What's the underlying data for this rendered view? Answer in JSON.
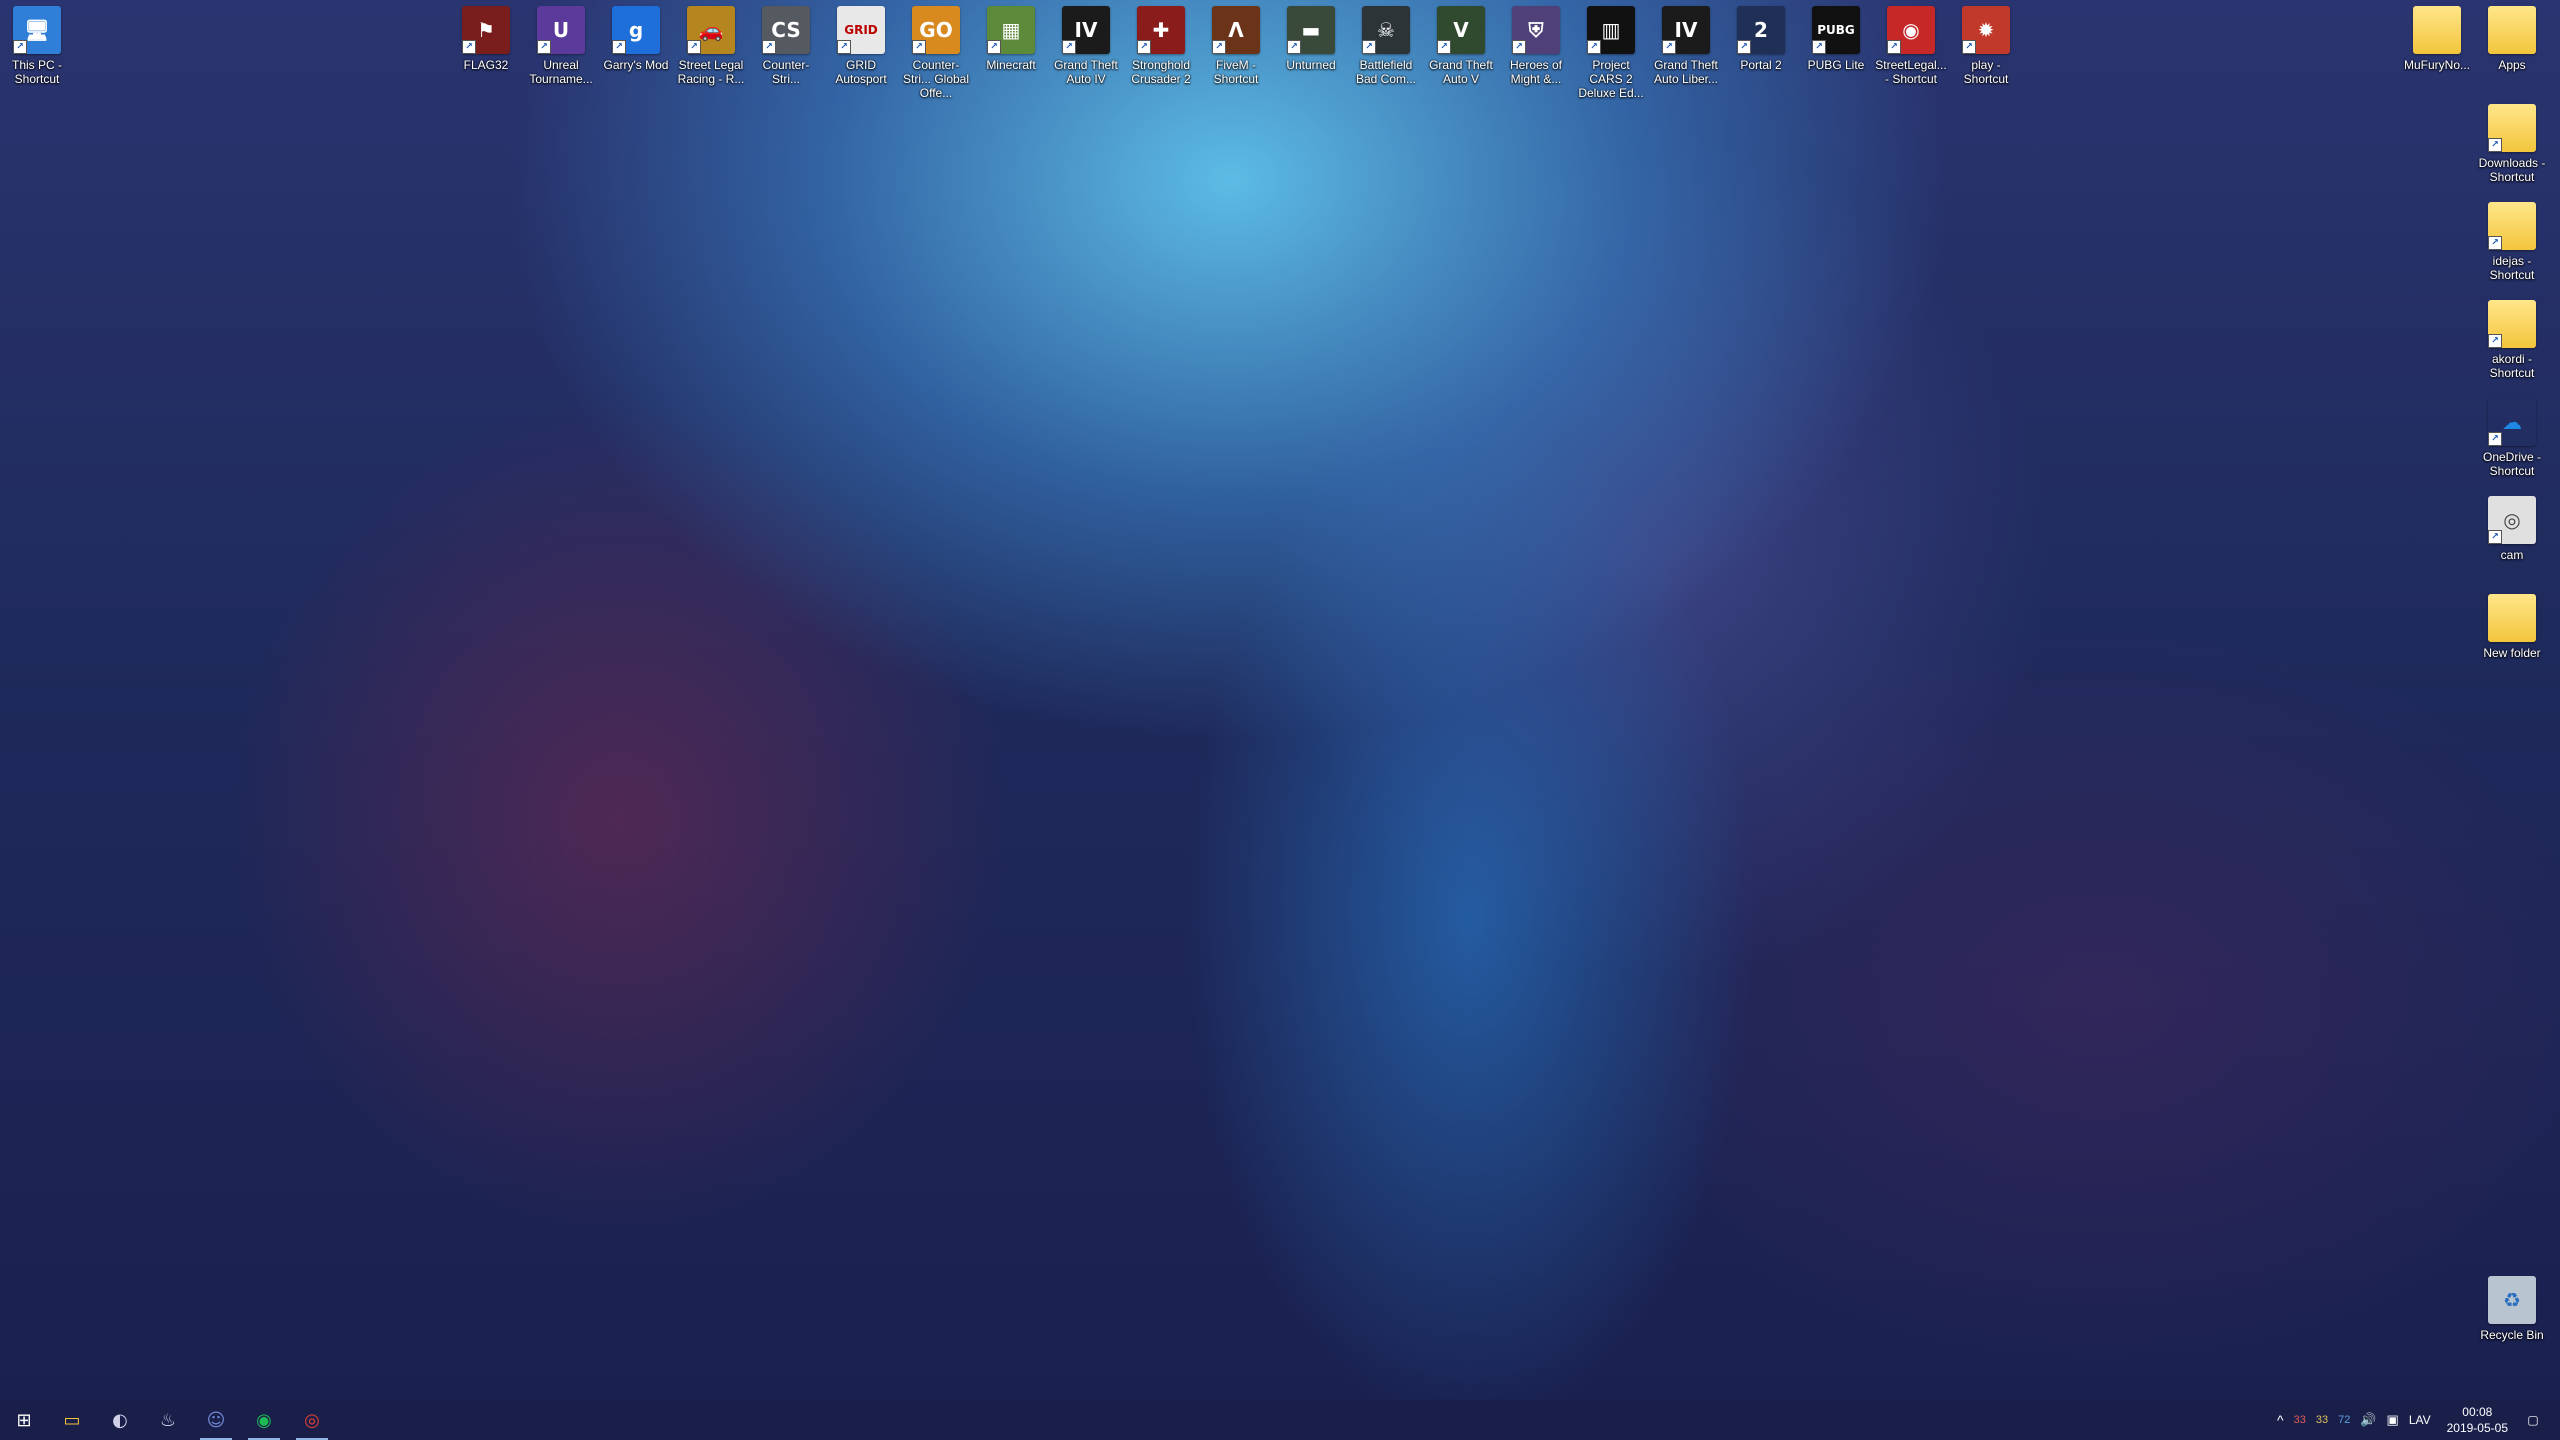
{
  "desktop": {
    "left_icons": [
      {
        "label": "This PC - Shortcut",
        "icon": "this-pc-icon"
      }
    ],
    "top_icons": [
      {
        "label": "FLAG32",
        "icon": "flag-game-icon",
        "color": "#7a1d1d",
        "glyph": "⚑"
      },
      {
        "label": "Unreal Tourname...",
        "icon": "unreal-icon",
        "color": "#5b3a9b",
        "glyph": "U"
      },
      {
        "label": "Garry's Mod",
        "icon": "garrys-mod-icon",
        "color": "#1e6fd9",
        "glyph": "g"
      },
      {
        "label": "Street Legal Racing - R...",
        "icon": "street-legal-car-icon",
        "color": "#b5851f",
        "glyph": "🚗"
      },
      {
        "label": "Counter-Stri...",
        "icon": "counter-strike-icon",
        "color": "#555a60",
        "glyph": "CS"
      },
      {
        "label": "GRID Autosport",
        "icon": "grid-autosport-icon",
        "color": "#e8e8e8",
        "glyph": "GRID"
      },
      {
        "label": "Counter-Stri... Global Offe...",
        "icon": "csgo-icon",
        "color": "#d98a1f",
        "glyph": "GO"
      },
      {
        "label": "Minecraft",
        "icon": "minecraft-icon",
        "color": "#5d8a3a",
        "glyph": "▦"
      },
      {
        "label": "Grand Theft Auto IV",
        "icon": "gta4-icon",
        "color": "#1b1b1b",
        "glyph": "IV"
      },
      {
        "label": "Stronghold Crusader 2",
        "icon": "stronghold-shield-icon",
        "color": "#8b1c1c",
        "glyph": "✚"
      },
      {
        "label": "FiveM - Shortcut",
        "icon": "fivem-icon",
        "color": "#6b3317",
        "glyph": "Λ"
      },
      {
        "label": "Unturned",
        "icon": "unturned-icon",
        "color": "#3a4a3a",
        "glyph": "▬"
      },
      {
        "label": "Battlefield Bad Com...",
        "icon": "battlefield-icon",
        "color": "#2c3438",
        "glyph": "☠"
      },
      {
        "label": "Grand Theft Auto V",
        "icon": "gta5-icon",
        "color": "#2f4a2f",
        "glyph": "V"
      },
      {
        "label": "Heroes of Might &...",
        "icon": "heroes-shield-icon",
        "color": "#50407a",
        "glyph": "⛨"
      },
      {
        "label": "Project CARS 2 Deluxe Ed...",
        "icon": "project-cars-icon",
        "color": "#111111",
        "glyph": "▥"
      },
      {
        "label": "Grand Theft Auto Liber...",
        "icon": "gta-liberty-icon",
        "color": "#1b1b1b",
        "glyph": "IV"
      },
      {
        "label": "Portal 2",
        "icon": "portal2-icon",
        "color": "#1f2f55",
        "glyph": "2"
      },
      {
        "label": "PUBG Lite",
        "icon": "pubg-lite-icon",
        "color": "#111111",
        "glyph": "PUBG"
      },
      {
        "label": "StreetLegal... - Shortcut",
        "icon": "streetlegal-disc-icon",
        "color": "#c62828",
        "glyph": "◉"
      },
      {
        "label": "play - Shortcut",
        "icon": "play-game-icon",
        "color": "#c0392b",
        "glyph": "✹"
      }
    ],
    "right_top_icons": [
      {
        "label": "MuFuryNo...",
        "icon": "folder-icon"
      },
      {
        "label": "Apps",
        "icon": "folder-warning-icon"
      }
    ],
    "right_column_icons": [
      {
        "label": "Downloads - Shortcut",
        "icon": "downloads-folder-icon"
      },
      {
        "label": "idejas - Shortcut",
        "icon": "document-folder-icon"
      },
      {
        "label": "akordi - Shortcut",
        "icon": "document-folder-icon"
      },
      {
        "label": "OneDrive - Shortcut",
        "icon": "onedrive-cloud-icon"
      },
      {
        "label": "cam",
        "icon": "camera-icon"
      },
      {
        "label": "New folder",
        "icon": "folder-icon"
      }
    ],
    "recycle_bin": {
      "label": "Recycle Bin",
      "icon": "recycle-bin-icon"
    }
  },
  "taskbar": {
    "buttons": [
      {
        "name": "start-button",
        "icon": "windows-logo-icon",
        "glyph": "⊞",
        "color": "#ffffff"
      },
      {
        "name": "file-explorer-button",
        "icon": "file-explorer-icon",
        "glyph": "▭",
        "color": "#f3c53c"
      },
      {
        "name": "app-button",
        "icon": "app-logo-icon",
        "glyph": "◐",
        "color": "#d0d0e8"
      },
      {
        "name": "steam-button",
        "icon": "steam-icon",
        "glyph": "♨",
        "color": "#cfd8e8"
      },
      {
        "name": "discord-button",
        "icon": "discord-icon",
        "glyph": "☺",
        "color": "#7289da"
      },
      {
        "name": "spotify-button",
        "icon": "spotify-icon",
        "glyph": "◉",
        "color": "#1db954"
      },
      {
        "name": "chrome-button",
        "icon": "chrome-icon",
        "glyph": "◎",
        "color": "#e34133"
      }
    ],
    "tray": {
      "chevron": "^",
      "temps": [
        {
          "value": "33",
          "color": "#e05a5a"
        },
        {
          "value": "33",
          "color": "#e0c05a"
        },
        {
          "value": "72",
          "color": "#5aa0e0"
        }
      ],
      "volume_glyph": "🔊",
      "network_glyph": "▣",
      "language": "LAV",
      "time": "00:08",
      "date": "2019-05-05",
      "notification_glyph": "▢"
    }
  }
}
